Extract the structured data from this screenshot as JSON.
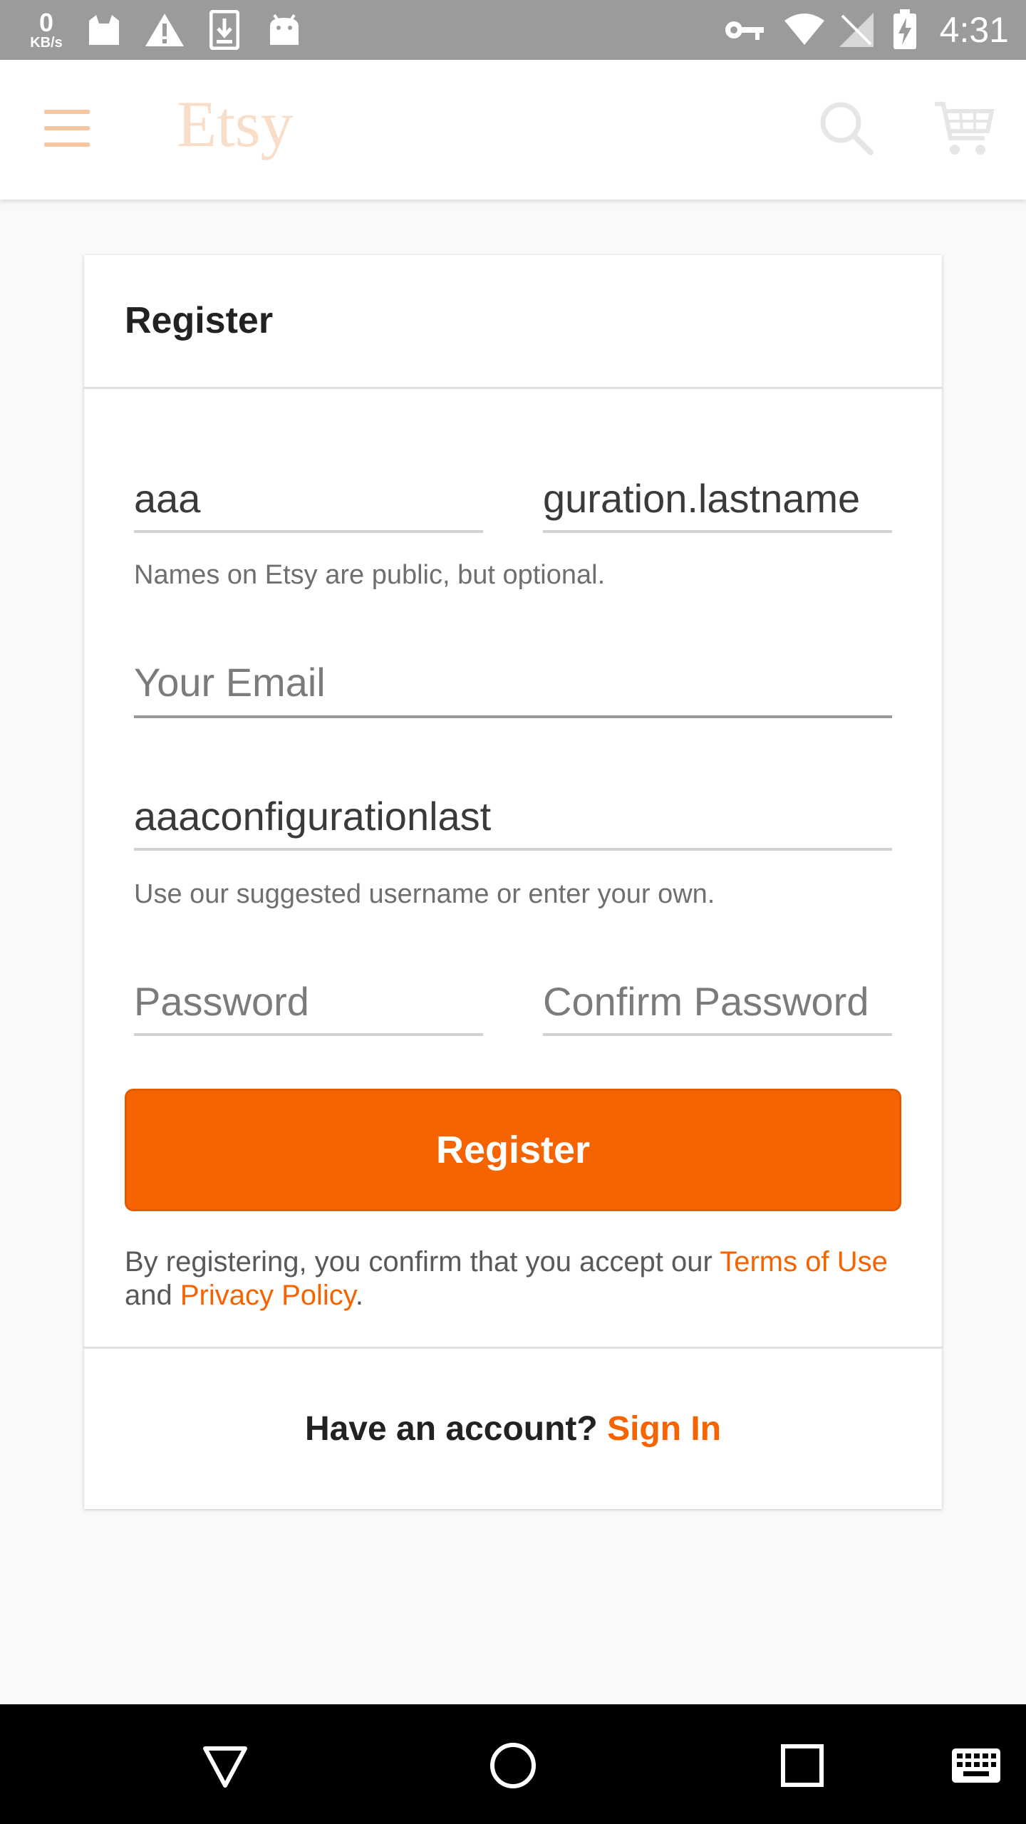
{
  "status_bar": {
    "net_speed_value": "0",
    "net_speed_unit": "KB/s",
    "time": "4:31",
    "icons": [
      "cat-icon",
      "warning-icon",
      "download-icon",
      "android-icon",
      "key-icon",
      "wifi-icon",
      "no-sim-icon",
      "battery-charging-icon"
    ]
  },
  "app_bar": {
    "logo": "Etsy",
    "icons": [
      "menu-icon",
      "search-icon",
      "cart-icon"
    ]
  },
  "form": {
    "title": "Register",
    "first_name_value": "aaa",
    "last_name_value": "guration.lastname",
    "names_helper": "Names on Etsy are public, but optional.",
    "email_placeholder": "Your Email",
    "username_value": "aaaconfigurationlast",
    "username_helper": "Use our suggested username or enter your own.",
    "password_placeholder": "Password",
    "confirm_password_placeholder": "Confirm Password",
    "register_button": "Register",
    "legal_prefix": "By registering, you confirm that you accept our ",
    "terms_link": "Terms of Use",
    "legal_and": " and ",
    "privacy_link": "Privacy Policy",
    "legal_suffix": ".",
    "have_account": "Have an account? ",
    "sign_in_link": "Sign In"
  },
  "colors": {
    "accent": "#f56400",
    "status_bar": "#9b9b9b",
    "nav_bar": "#000000"
  },
  "nav_bar": {
    "icons": [
      "back-icon",
      "home-icon",
      "recents-icon",
      "keyboard-icon"
    ]
  }
}
